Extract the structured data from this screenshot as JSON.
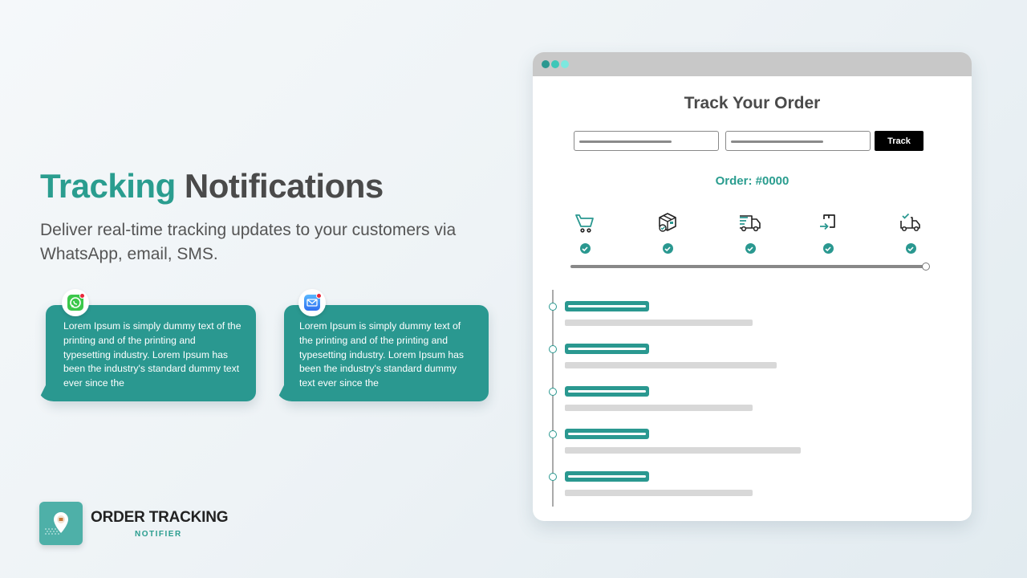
{
  "hero": {
    "title_accent": "Tracking",
    "title_rest": "Notifications",
    "subtitle": "Deliver real-time tracking updates to your customers via WhatsApp, email, SMS.",
    "accent_color": "#2a9d8f"
  },
  "notifications": [
    {
      "channel": "whatsapp",
      "icon": "whatsapp-icon",
      "text": "Lorem Ipsum is simply dummy text of the printing and of the printing and typesetting industry. Lorem Ipsum has been the industry's standard dummy text ever since the"
    },
    {
      "channel": "email",
      "icon": "mail-icon",
      "text": "Lorem Ipsum is simply dummy text of the printing and of the printing and typesetting industry. Lorem Ipsum has been the industry's standard dummy text ever since the"
    }
  ],
  "brand": {
    "name": "ORDER TRACKING",
    "sub": "NOTIFIER",
    "logo_icon": "map-pin-icon"
  },
  "mockup": {
    "title": "Track Your Order",
    "track_button": "Track",
    "order_label": "Order: #0000",
    "steps": [
      {
        "icon": "cart-icon",
        "done": true
      },
      {
        "icon": "package-icon",
        "done": true
      },
      {
        "icon": "delivery-truck-icon",
        "done": true
      },
      {
        "icon": "arrive-icon",
        "done": true
      },
      {
        "icon": "delivered-truck-icon",
        "done": true
      }
    ],
    "progress_percent": 100,
    "timeline_count": 5
  }
}
